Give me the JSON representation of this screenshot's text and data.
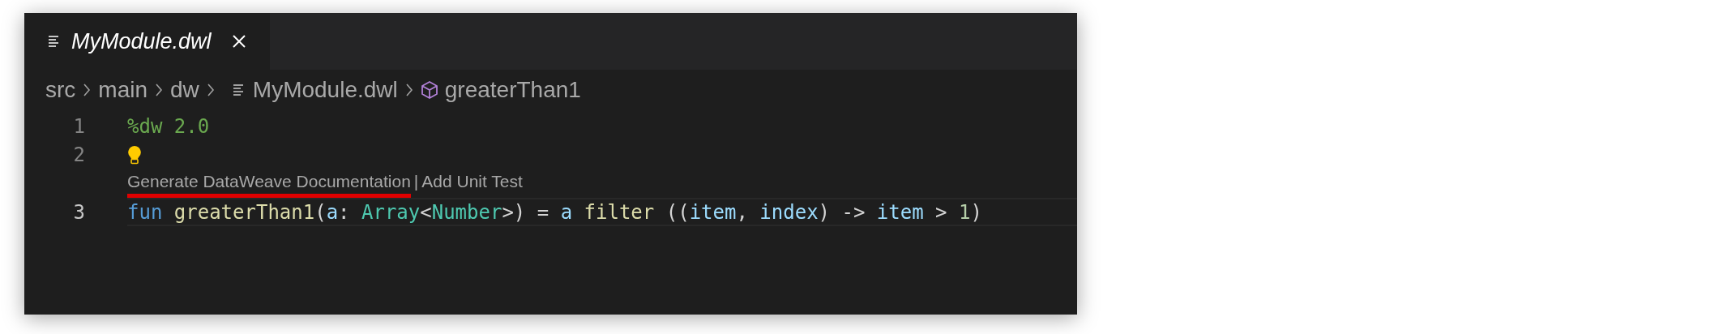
{
  "tabs": [
    {
      "label": "MyModule.dwl",
      "selected": true,
      "italic": true
    }
  ],
  "breadcrumb": [
    {
      "label": "src",
      "kind": "folder"
    },
    {
      "label": "main",
      "kind": "folder"
    },
    {
      "label": "dw",
      "kind": "folder"
    },
    {
      "label": "MyModule.dwl",
      "kind": "file"
    },
    {
      "label": "greaterThan1",
      "kind": "symbol"
    }
  ],
  "lines": [
    {
      "number": "1",
      "current": false,
      "tokens": [
        {
          "text": "%dw 2.0",
          "kind": "directive"
        }
      ]
    },
    {
      "number": "2",
      "current": false,
      "lightbulb": true
    },
    {
      "number": "3",
      "current": true,
      "codelens": [
        {
          "label": "Generate DataWeave Documentation",
          "highlighted": true
        },
        {
          "label": "Add Unit Test",
          "highlighted": false
        }
      ],
      "codelens_separator": "|",
      "tokens": [
        {
          "text": "fun ",
          "kind": "keyword"
        },
        {
          "text": "greaterThan1",
          "kind": "function"
        },
        {
          "text": "(",
          "kind": "plain"
        },
        {
          "text": "a",
          "kind": "variable"
        },
        {
          "text": ": ",
          "kind": "plain"
        },
        {
          "text": "Array",
          "kind": "type"
        },
        {
          "text": "<",
          "kind": "plain"
        },
        {
          "text": "Number",
          "kind": "type"
        },
        {
          "text": ">) = ",
          "kind": "plain"
        },
        {
          "text": "a ",
          "kind": "variable"
        },
        {
          "text": "filter",
          "kind": "function"
        },
        {
          "text": " ((",
          "kind": "plain"
        },
        {
          "text": "item",
          "kind": "variable"
        },
        {
          "text": ", ",
          "kind": "plain"
        },
        {
          "text": "index",
          "kind": "variable"
        },
        {
          "text": ") -> ",
          "kind": "plain"
        },
        {
          "text": "item",
          "kind": "variable"
        },
        {
          "text": " > ",
          "kind": "plain"
        },
        {
          "text": "1",
          "kind": "number"
        },
        {
          "text": ")",
          "kind": "plain"
        }
      ]
    }
  ]
}
